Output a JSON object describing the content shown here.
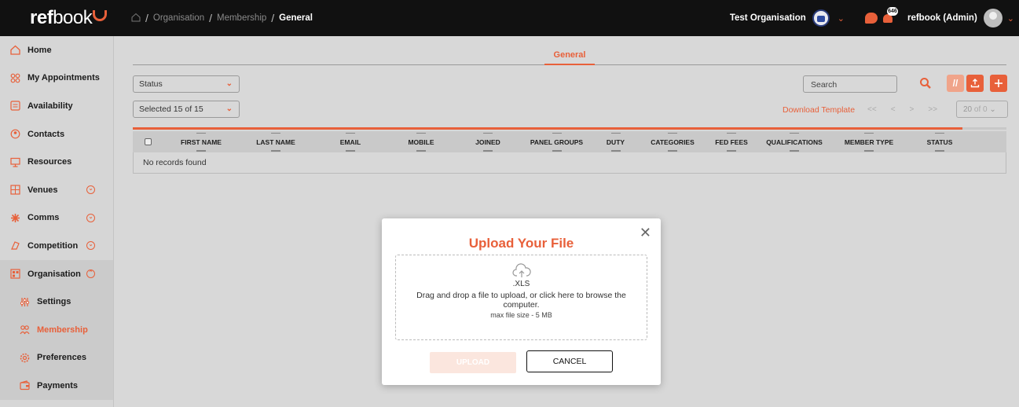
{
  "brand": {
    "logo_bold": "ref",
    "logo_thin": "book"
  },
  "breadcrumb": {
    "items": [
      "Organisation",
      "Membership"
    ],
    "current": "General"
  },
  "header": {
    "org_name": "Test Organisation",
    "user_name": "refbook (Admin)",
    "notification_count": "646"
  },
  "sidebar": {
    "items": [
      {
        "label": "Home",
        "icon": "home-icon"
      },
      {
        "label": "My Appointments",
        "icon": "appointments-icon"
      },
      {
        "label": "Availability",
        "icon": "availability-icon"
      },
      {
        "label": "Contacts",
        "icon": "contacts-icon"
      },
      {
        "label": "Resources",
        "icon": "resources-icon"
      },
      {
        "label": "Venues",
        "icon": "venues-icon"
      },
      {
        "label": "Comms",
        "icon": "comms-icon"
      },
      {
        "label": "Competition",
        "icon": "competition-icon"
      },
      {
        "label": "Organisation",
        "icon": "organisation-icon"
      },
      {
        "label": "Settings",
        "icon": "settings-icon"
      },
      {
        "label": "Membership",
        "icon": "membership-icon"
      },
      {
        "label": "Preferences",
        "icon": "preferences-icon"
      },
      {
        "label": "Payments",
        "icon": "payments-icon"
      }
    ]
  },
  "tabs": {
    "active": "General"
  },
  "filters": {
    "status": "Status",
    "selected": "Selected 15 of 15"
  },
  "search": {
    "placeholder": "Search"
  },
  "toolbar": {
    "download_template": "Download Template",
    "page_size": "20",
    "page_size_suffix": "of 0"
  },
  "progress": 0.95,
  "table": {
    "columns": [
      "FIRST NAME",
      "LAST NAME",
      "EMAIL",
      "MOBILE",
      "JOINED",
      "PANEL GROUPS",
      "DUTY",
      "CATEGORIES",
      "FED FEES",
      "QUALIFICATIONS",
      "MEMBER TYPE",
      "STATUS"
    ],
    "empty_text": "No records found"
  },
  "modal": {
    "title": "Upload Your File",
    "file_type": ".XLS",
    "instructions": "Drag and drop a file to upload, or click here to browse the computer.",
    "max_size": "max file size - 5 MB",
    "upload_label": "UPLOAD",
    "cancel_label": "CANCEL"
  },
  "colors": {
    "accent": "#e8603a",
    "topbar": "#111111"
  }
}
